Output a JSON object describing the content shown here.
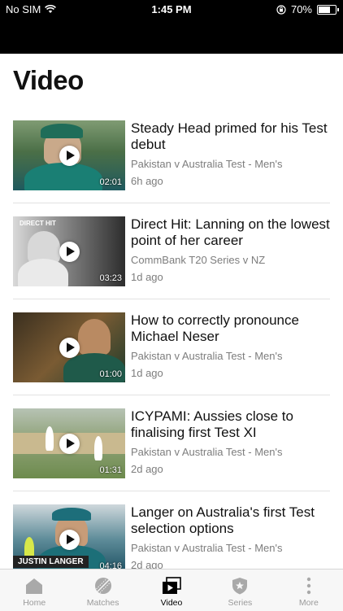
{
  "status_bar": {
    "carrier": "No SIM",
    "time": "1:45 PM",
    "battery": "70%",
    "battery_level": 0.7
  },
  "page": {
    "title": "Video"
  },
  "videos": [
    {
      "title": "Steady Head primed for his Test debut",
      "series": "Pakistan v Australia Test - Men's",
      "time_ago": "6h ago",
      "duration": "02:01"
    },
    {
      "title": "Direct Hit: Lanning on the lowest point of her career",
      "series": "CommBank T20 Series v NZ",
      "time_ago": "1d ago",
      "duration": "03:23",
      "tag": "DIRECT HIT"
    },
    {
      "title": "How to correctly pronounce Michael Neser",
      "series": "Pakistan v Australia Test - Men's",
      "time_ago": "1d ago",
      "duration": "01:00"
    },
    {
      "title": "ICYPAMI: Aussies close to finalising first Test XI",
      "series": "Pakistan v Australia Test - Men's",
      "time_ago": "2d ago",
      "duration": "01:31"
    },
    {
      "title": "Langer on Australia's first Test selection options",
      "series": "Pakistan v Australia Test - Men's",
      "time_ago": "2d ago",
      "duration": "04:16",
      "nameplate": "JUSTIN LANGER"
    }
  ],
  "tab_bar": {
    "tabs": [
      {
        "label": "Home",
        "icon": "home-icon"
      },
      {
        "label": "Matches",
        "icon": "ball-icon"
      },
      {
        "label": "Video",
        "icon": "video-icon"
      },
      {
        "label": "Series",
        "icon": "shield-icon"
      },
      {
        "label": "More",
        "icon": "more-icon"
      }
    ],
    "active": "Video"
  },
  "colors": {
    "status_bar_bg": "#000000",
    "meta_text": "#7d7d7d",
    "inactive_tab": "#9a9a9a",
    "active_tab": "#000000"
  }
}
